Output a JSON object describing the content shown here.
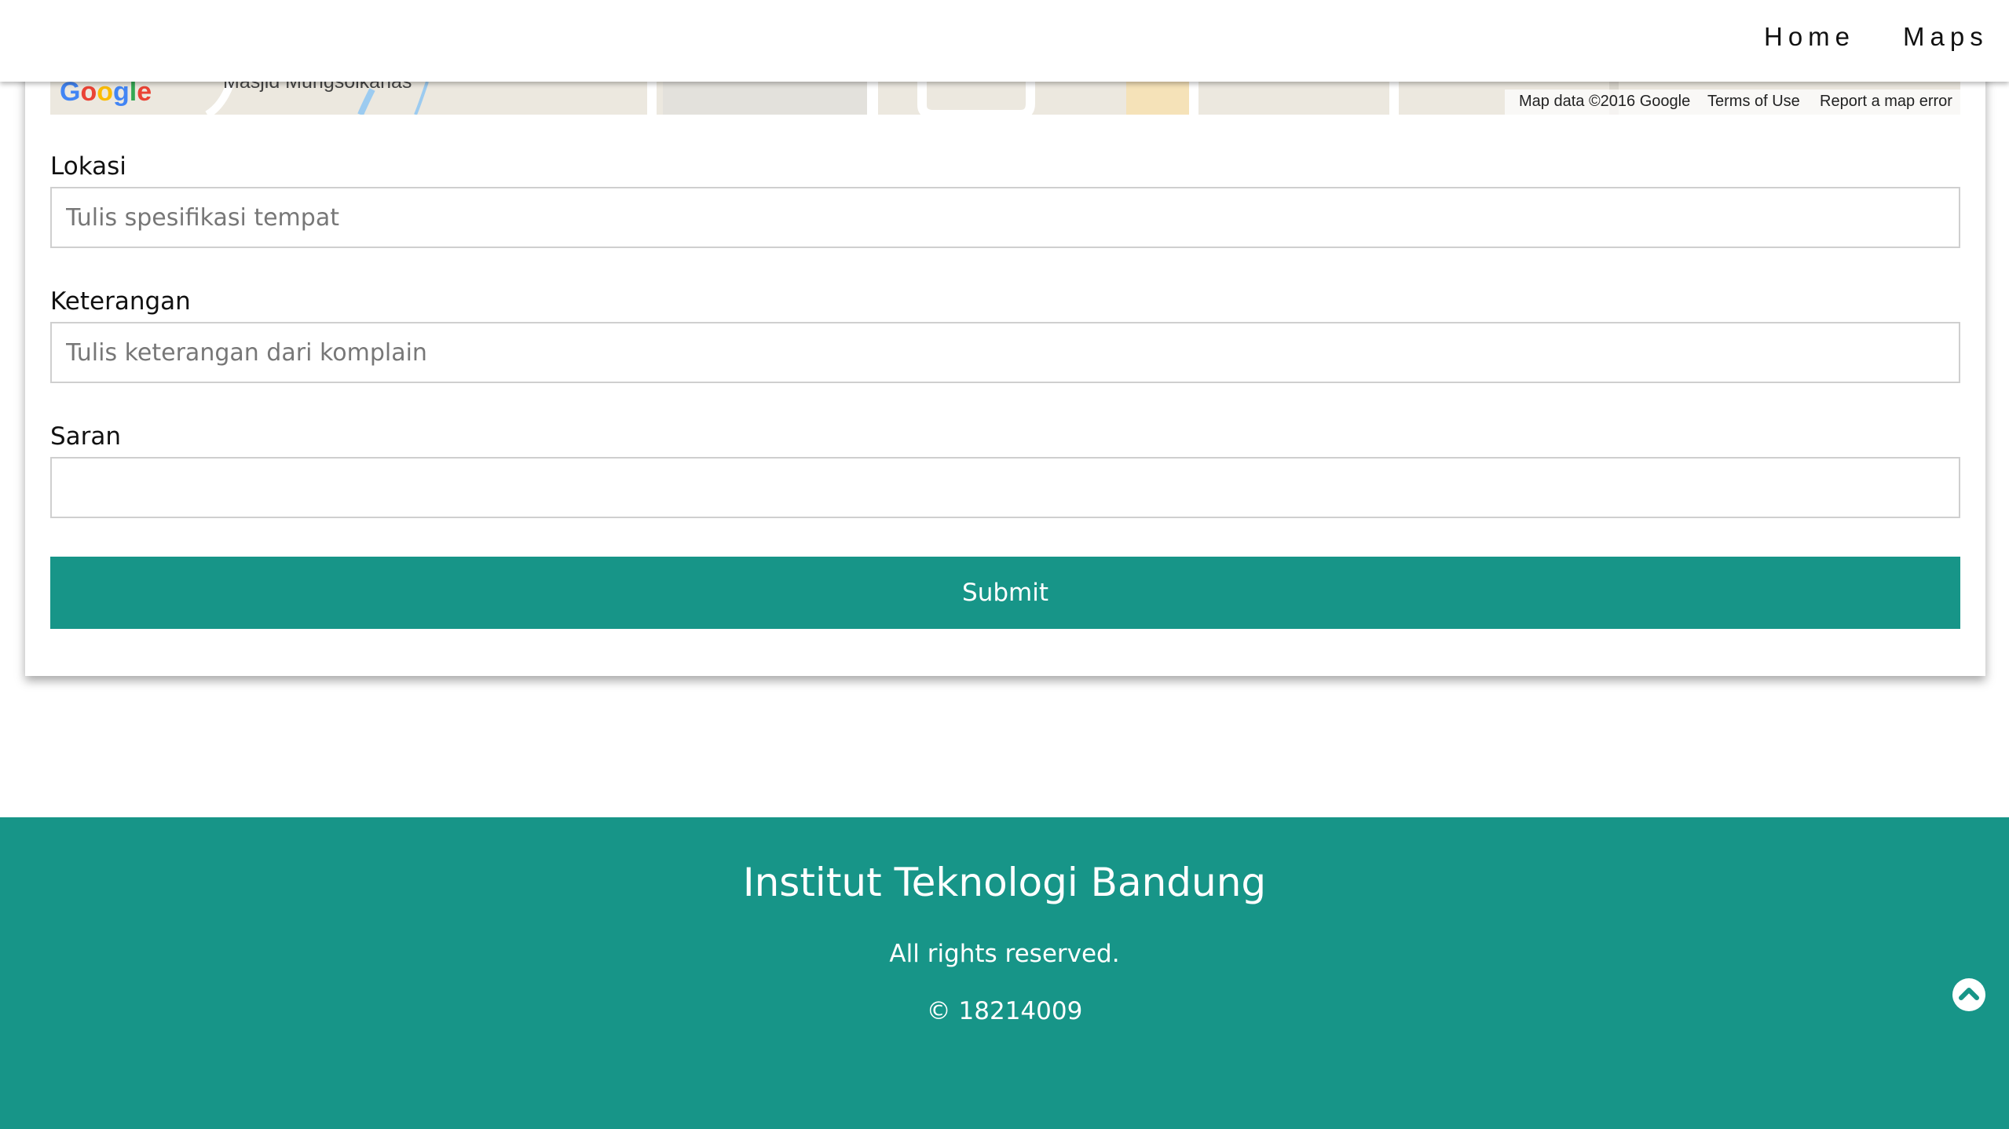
{
  "nav": {
    "home": "Home",
    "maps": "Maps"
  },
  "map": {
    "logo": "Google",
    "place_label": "Masjid Mungsolkanas",
    "attribution": "Map data ©2016 Google",
    "terms": "Terms of Use",
    "report": "Report a map error"
  },
  "form": {
    "lokasi_label": "Lokasi",
    "lokasi_placeholder": "Tulis spesifikasi tempat",
    "keterangan_label": "Keterangan",
    "keterangan_placeholder": "Tulis keterangan dari komplain",
    "saran_label": "Saran",
    "saran_value": "",
    "submit_label": "Submit"
  },
  "footer": {
    "title": "Institut Teknologi Bandung",
    "rights": "All rights reserved.",
    "copyright": "© 18214009"
  },
  "colors": {
    "accent": "#179588",
    "card": "#ffffff",
    "input_border": "#cfcfcf"
  },
  "icons": {
    "scroll_top": "chevron-up-circle-icon"
  }
}
